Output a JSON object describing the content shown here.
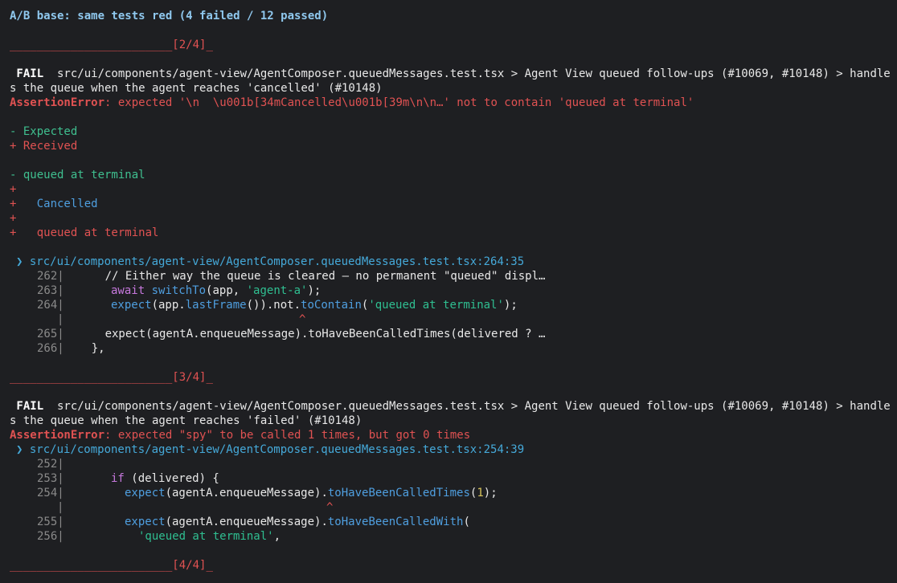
{
  "header": {
    "text": "A/B base: same tests red (4 failed / 12 passed)"
  },
  "separators": {
    "s2": {
      "rule": "________________________",
      "label": "[2/4]",
      "tail": "_"
    },
    "s3": {
      "rule": "________________________",
      "label": "[3/4]",
      "tail": "_"
    },
    "s4": {
      "rule": "________________________",
      "label": "[4/4]",
      "tail": "_"
    }
  },
  "fail1": {
    "tag": " FAIL ",
    "line1": " src/ui/components/agent-view/AgentComposer.queuedMessages.test.tsx > Agent View queued follow-ups (#10069, #10148) > handle",
    "line2": "s the queue when the agent reaches 'cancelled' (#10148)",
    "error_name": "AssertionError",
    "error_msg": ": expected '\\n  \\u001b[34mCancelled\\u001b[39m\\n\\n…' not to contain 'queued at terminal'",
    "diff": {
      "expected_label": "- Expected",
      "received_label": "+ Received",
      "minus_line": "- queued at terminal",
      "plus_empty": "+",
      "plus_cancelled_prefix": "+   ",
      "plus_cancelled_word": "Cancelled",
      "plus_queued": "+   queued at terminal"
    },
    "location": "❯ src/ui/components/agent-view/AgentComposer.queuedMessages.test.tsx:264:35",
    "code": {
      "n262": "262|",
      "c262": "      // Either way the queue is cleared — no permanent \"queued\" displ…",
      "n263": "263|",
      "c263_kw": "await",
      "c263_fn": "switchTo",
      "c263_a": "(app, ",
      "c263_str": "'agent-a'",
      "c263_b": ");",
      "n264": "264|",
      "c264_fn1": "expect",
      "c264_a": "(app.",
      "c264_fn2": "lastFrame",
      "c264_b": "()).not.",
      "c264_fn3": "toContain",
      "c264_c": "(",
      "c264_str": "'queued at terminal'",
      "c264_d": ");",
      "pipe": "|",
      "caret": "^",
      "n265": "265|",
      "c265": "      expect(agentA.enqueueMessage).toHaveBeenCalledTimes(delivered ? …",
      "n266": "266|",
      "c266": "    },"
    }
  },
  "fail2": {
    "tag": " FAIL ",
    "line1": " src/ui/components/agent-view/AgentComposer.queuedMessages.test.tsx > Agent View queued follow-ups (#10069, #10148) > handle",
    "line2": "s the queue when the agent reaches 'failed' (#10148)",
    "error_name": "AssertionError",
    "error_msg": ": expected \"spy\" to be called 1 times, but got 0 times",
    "location": "❯ src/ui/components/agent-view/AgentComposer.queuedMessages.test.tsx:254:39",
    "code": {
      "n252": "252|",
      "n253": "253|",
      "c253_kw": "if",
      "c253_a": " (delivered) {",
      "n254": "254|",
      "c254_fn1": "expect",
      "c254_a": "(agentA.enqueueMessage).",
      "c254_fn2": "toHaveBeenCalledTimes",
      "c254_b": "(",
      "c254_num": "1",
      "c254_c": ");",
      "pipe": "|",
      "caret": "^",
      "n255": "255|",
      "c255_fn1": "expect",
      "c255_a": "(agentA.enqueueMessage).",
      "c255_fn2": "toHaveBeenCalledWith",
      "c255_b": "(",
      "n256": "256|",
      "c256_str": "'queued at terminal'",
      "c256_a": ","
    }
  }
}
